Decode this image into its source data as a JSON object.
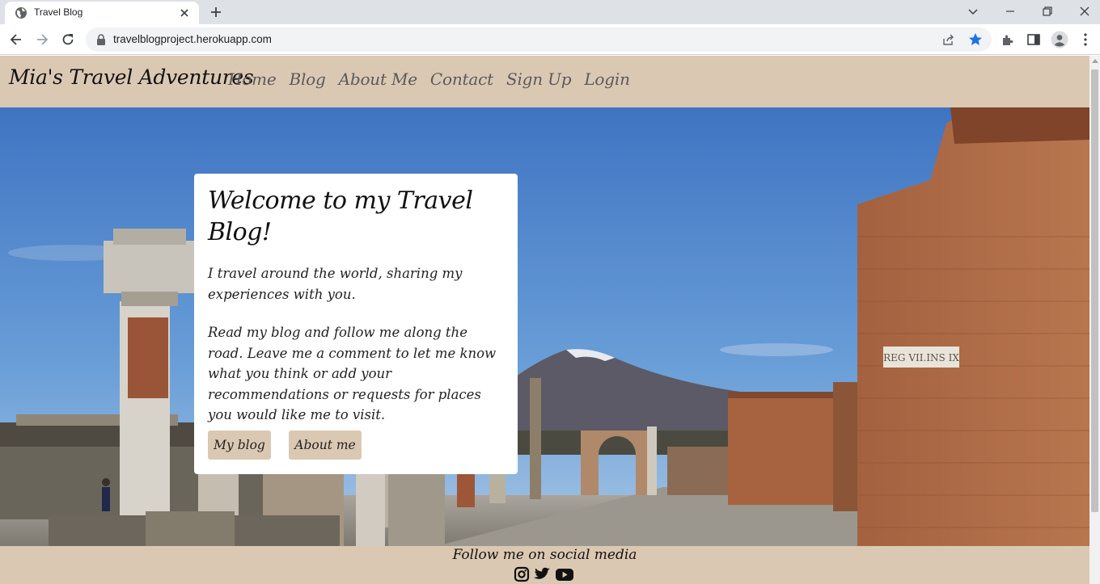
{
  "browser": {
    "tab_title": "Travel Blog",
    "url": "travelblogproject.herokuapp.com"
  },
  "site": {
    "brand": "Mia's Travel Adventures",
    "nav": [
      "Home",
      "Blog",
      "About Me",
      "Contact",
      "Sign Up",
      "Login"
    ]
  },
  "hero_card": {
    "title": "Welcome to my Travel Blog!",
    "intro": "I travel around the world, sharing my experiences with you.",
    "body": "Read my blog and follow me along the road. Leave me a comment to let me know what you think or add your recommendations or requests for places you would like me to visit.",
    "buttons": [
      "My blog",
      "About me"
    ]
  },
  "hero_image": {
    "sign_text": "REG VII.INS IX"
  },
  "footer": {
    "text": "Follow me on social media",
    "icons": [
      "instagram-icon",
      "twitter-icon",
      "youtube-icon"
    ]
  },
  "colors": {
    "tan": "#dbc8b3",
    "brick": "#9e5a3c",
    "sky": "#5a8fce"
  }
}
